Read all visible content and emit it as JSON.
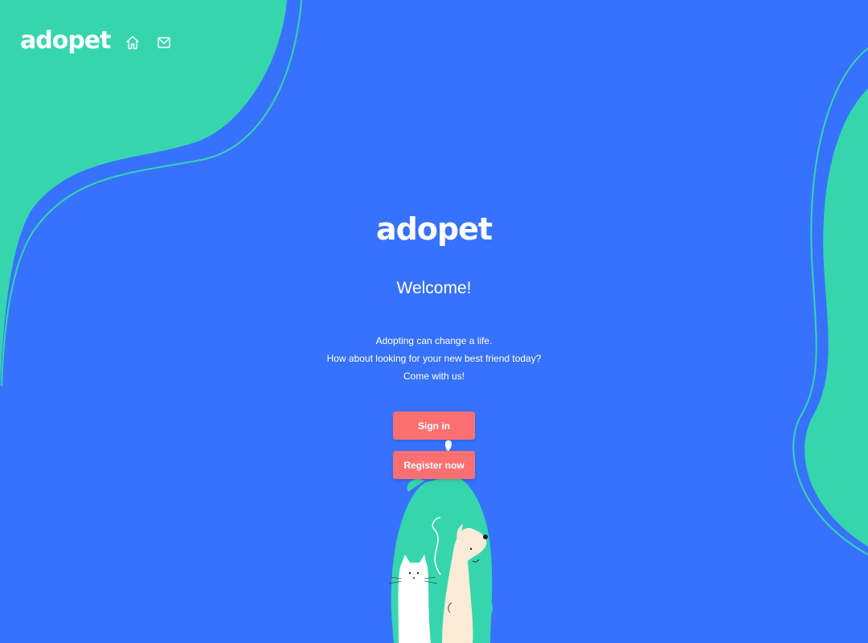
{
  "header": {
    "logo_text": "adopet",
    "nav": [
      {
        "icon": "home-icon"
      },
      {
        "icon": "mail-icon"
      }
    ]
  },
  "main": {
    "logo_text": "adopet",
    "welcome": "Welcome!",
    "description_lines": [
      "Adopting can change a life.",
      "How about looking for your new best friend today?",
      "Come with us!"
    ],
    "signin_label": "Sign in",
    "register_label": "Register now"
  },
  "colors": {
    "background": "#3772FF",
    "accent_green": "#36D6AD",
    "button": "#FC7071",
    "text": "#FFFFFF"
  }
}
